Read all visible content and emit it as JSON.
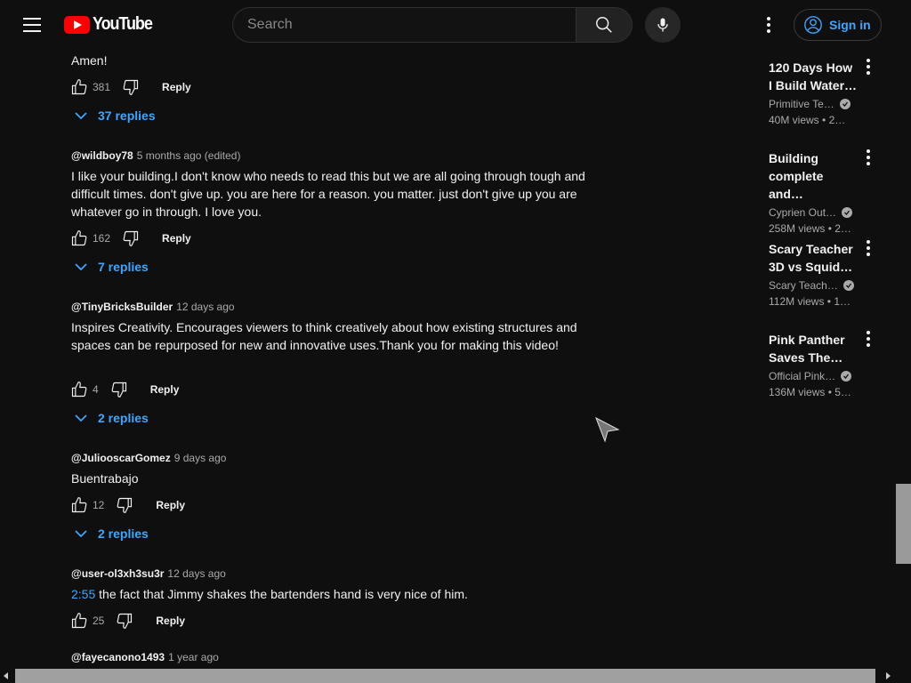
{
  "header": {
    "logo_text": "YouTube",
    "search_placeholder": "Search",
    "signin_label": "Sign in"
  },
  "comments": [
    {
      "author": "",
      "time": "",
      "text": "Amen!",
      "likes": "381",
      "reply_label": "Reply",
      "replies_label": "37 replies"
    },
    {
      "author": "@wildboy78",
      "time": "5 months ago (edited)",
      "text": "I like your building.I don't know who needs to read this but we are all going through tough and difficult times. don't give up. you are here for a reason. you matter. just don't give up you are whatever go in through. I love you.",
      "likes": "162",
      "reply_label": "Reply",
      "replies_label": "7 replies"
    },
    {
      "author": "@TinyBricksBuilder",
      "time": "12 days ago",
      "text": "Inspires Creativity. Encourages viewers to think creatively about how existing structures and spaces can be repurposed for new and innovative uses.Thank you for making this video!",
      "likes": "4",
      "reply_label": "Reply",
      "replies_label": "2 replies"
    },
    {
      "author": "@JuliooscarGomez",
      "time": "9 days ago",
      "text": "Buentrabajo",
      "likes": "12",
      "reply_label": "Reply",
      "replies_label": "2 replies"
    },
    {
      "author": "@user-ol3xh3su3r",
      "time": "12 days ago",
      "timestamp_link": "2:55",
      "text": " the fact that Jimmy shakes the bartenders hand is very nice of him.",
      "likes": "25",
      "reply_label": "Reply"
    },
    {
      "author": "@fayecanono1493",
      "time": "1 year ago"
    }
  ],
  "sidebar": {
    "items": [
      {
        "title": "120 Days How I Build Water…",
        "channel": "Primitive Te…",
        "views": "40M views",
        "age": "2…"
      },
      {
        "title": "Building complete and…",
        "channel": "Cyprien Out…",
        "views": "258M views",
        "age": "2…"
      },
      {
        "title": "Scary Teacher 3D vs Squid…",
        "channel": "Scary Teach…",
        "views": "112M views",
        "age": "1…"
      },
      {
        "title": "Pink Panther Saves The…",
        "channel": "Official Pink…",
        "views": "136M views",
        "age": "5…"
      }
    ]
  },
  "colors": {
    "background": "#0f0f0f",
    "link_blue": "#3ea6ff",
    "brand_red": "#ff0000"
  }
}
